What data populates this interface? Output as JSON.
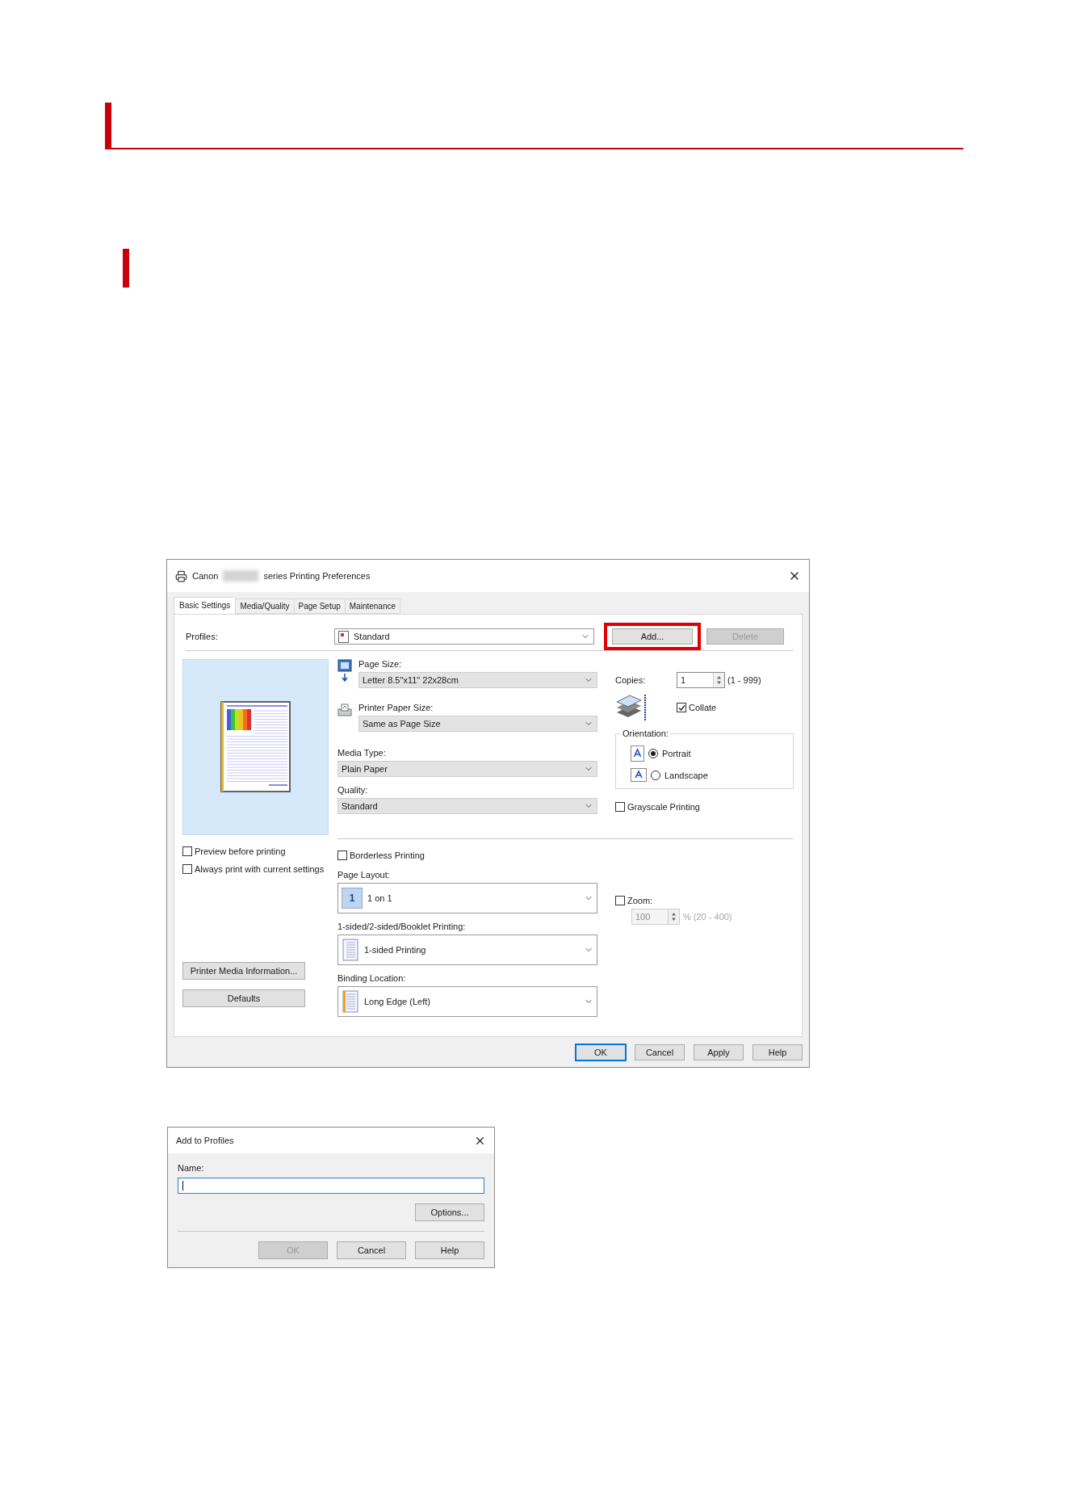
{
  "main_dialog": {
    "title_prefix": "Canon",
    "title_suffix": "series Printing Preferences",
    "tabs": [
      {
        "label": "Basic Settings",
        "selected": true
      },
      {
        "label": "Media/Quality",
        "selected": false
      },
      {
        "label": "Page Setup",
        "selected": false
      },
      {
        "label": "Maintenance",
        "selected": false
      }
    ],
    "profiles": {
      "label": "Profiles:",
      "value": "Standard"
    },
    "add_button": {
      "label": "Add...",
      "highlighted": true
    },
    "delete_button": {
      "label": "Delete",
      "disabled": true
    },
    "page_size": {
      "label": "Page Size:",
      "value": "Letter 8.5\"x11\" 22x28cm"
    },
    "printer_paper_size": {
      "label": "Printer Paper Size:",
      "value": "Same as Page Size"
    },
    "media_type": {
      "label": "Media Type:",
      "value": "Plain Paper"
    },
    "quality": {
      "label": "Quality:",
      "value": "Standard"
    },
    "copies": {
      "label": "Copies:",
      "value": "1",
      "range": "(1 - 999)"
    },
    "collate": {
      "label": "Collate",
      "checked": true
    },
    "orientation": {
      "label": "Orientation:",
      "options": [
        {
          "label": "Portrait",
          "selected": true
        },
        {
          "label": "Landscape",
          "selected": false
        }
      ]
    },
    "grayscale": {
      "label": "Grayscale Printing",
      "checked": false
    },
    "left_checks": [
      {
        "label": "Preview before printing",
        "checked": false
      },
      {
        "label": "Always print with current settings",
        "checked": false
      }
    ],
    "side_buttons": [
      "Printer Media Information...",
      "Defaults"
    ],
    "borderless": {
      "label": "Borderless Printing",
      "checked": false
    },
    "page_layout": {
      "label": "Page Layout:",
      "icon_label": "1",
      "value": "1 on 1"
    },
    "duplex": {
      "label": "1-sided/2-sided/Booklet Printing:",
      "value": "1-sided Printing"
    },
    "binding": {
      "label": "Binding Location:",
      "value": "Long Edge (Left)"
    },
    "zoom": {
      "label": "Zoom:",
      "checked": false,
      "disabled": true,
      "value": "100",
      "range": "% (20 - 400)"
    },
    "buttons": [
      {
        "label": "OK",
        "focused": true
      },
      {
        "label": "Cancel",
        "focused": false
      },
      {
        "label": "Apply",
        "focused": false
      },
      {
        "label": "Help",
        "focused": false
      }
    ]
  },
  "add_dialog": {
    "title": "Add to Profiles",
    "name_label": "Name:",
    "options_button": "Options...",
    "buttons": [
      {
        "label": "OK",
        "disabled": true
      },
      {
        "label": "Cancel",
        "disabled": false
      },
      {
        "label": "Help",
        "disabled": false
      }
    ]
  }
}
